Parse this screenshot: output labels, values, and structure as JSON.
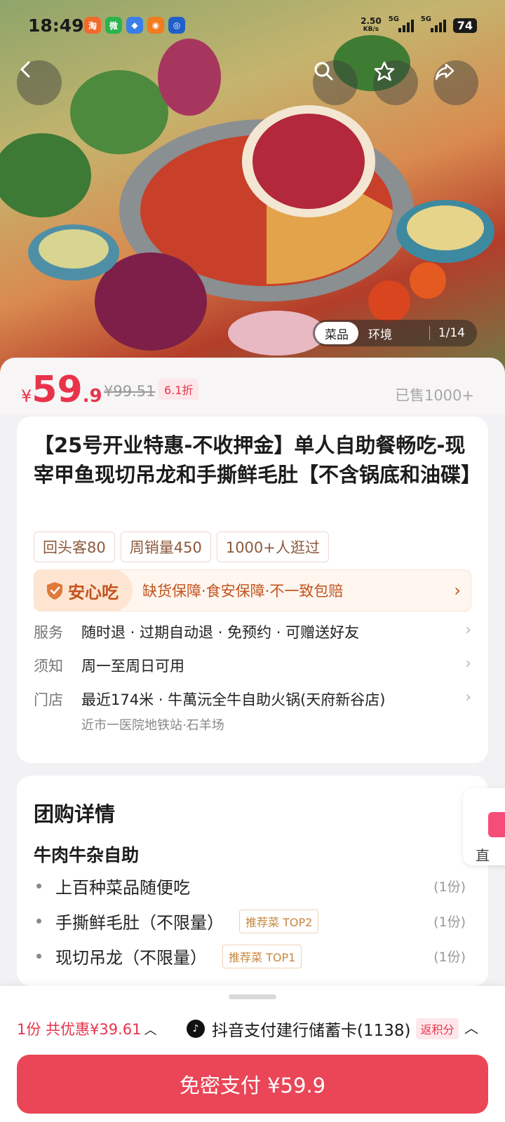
{
  "status": {
    "time": "18:49",
    "net_speed": "2.50",
    "net_unit": "KB/s",
    "net1": "5G",
    "net2": "5G",
    "battery": "74"
  },
  "gallery": {
    "tabs": [
      "菜品",
      "环境"
    ],
    "counter": "1/14"
  },
  "price": {
    "currency": "¥",
    "integer": "59",
    "decimal": ".9",
    "original": "¥99.51",
    "discount": "6.1折",
    "sold": "已售1000+"
  },
  "product": {
    "title": "【25号开业特惠-不收押金】单人自助餐畅吃-现宰甲鱼现切吊龙和手撕鲜毛肚【不含锅底和油碟】",
    "tags": [
      "回头客80",
      "周销量450",
      "1000+人逛过"
    ],
    "assurance": {
      "title": "安心吃",
      "text": "缺货保障·食安保障·不一致包赔"
    },
    "info": [
      {
        "label": "服务",
        "value": "随时退 · 过期自动退 · 免预约 · 可赠送好友"
      },
      {
        "label": "须知",
        "value": "周一至周日可用"
      },
      {
        "label": "门店",
        "value": "最近174米 · 牛萬沅全牛自助火锅(天府新谷店)",
        "sub": "近市一医院地铁站·石羊场"
      }
    ]
  },
  "detail": {
    "heading": "团购详情",
    "section": "牛肉牛杂自助",
    "items": [
      {
        "name": "上百种菜品随便吃",
        "badge": "",
        "qty": "(1份)"
      },
      {
        "name": "手撕鲜毛肚（不限量）",
        "badge": "推荐菜 TOP2",
        "qty": "(1份)"
      },
      {
        "name": "现切吊龙（不限量）",
        "badge": "推荐菜 TOP1",
        "qty": "(1份)"
      }
    ]
  },
  "float": {
    "label": "直"
  },
  "bottom": {
    "summary": "1份 共优惠¥39.61",
    "pay_method": "抖音支付建行储蓄卡(1138)",
    "points": "返积分",
    "button": "免密支付 ¥59.9"
  },
  "colors": {
    "accent": "#e8334a",
    "pay_button": "#ea4658",
    "assure": "#c2531f"
  }
}
